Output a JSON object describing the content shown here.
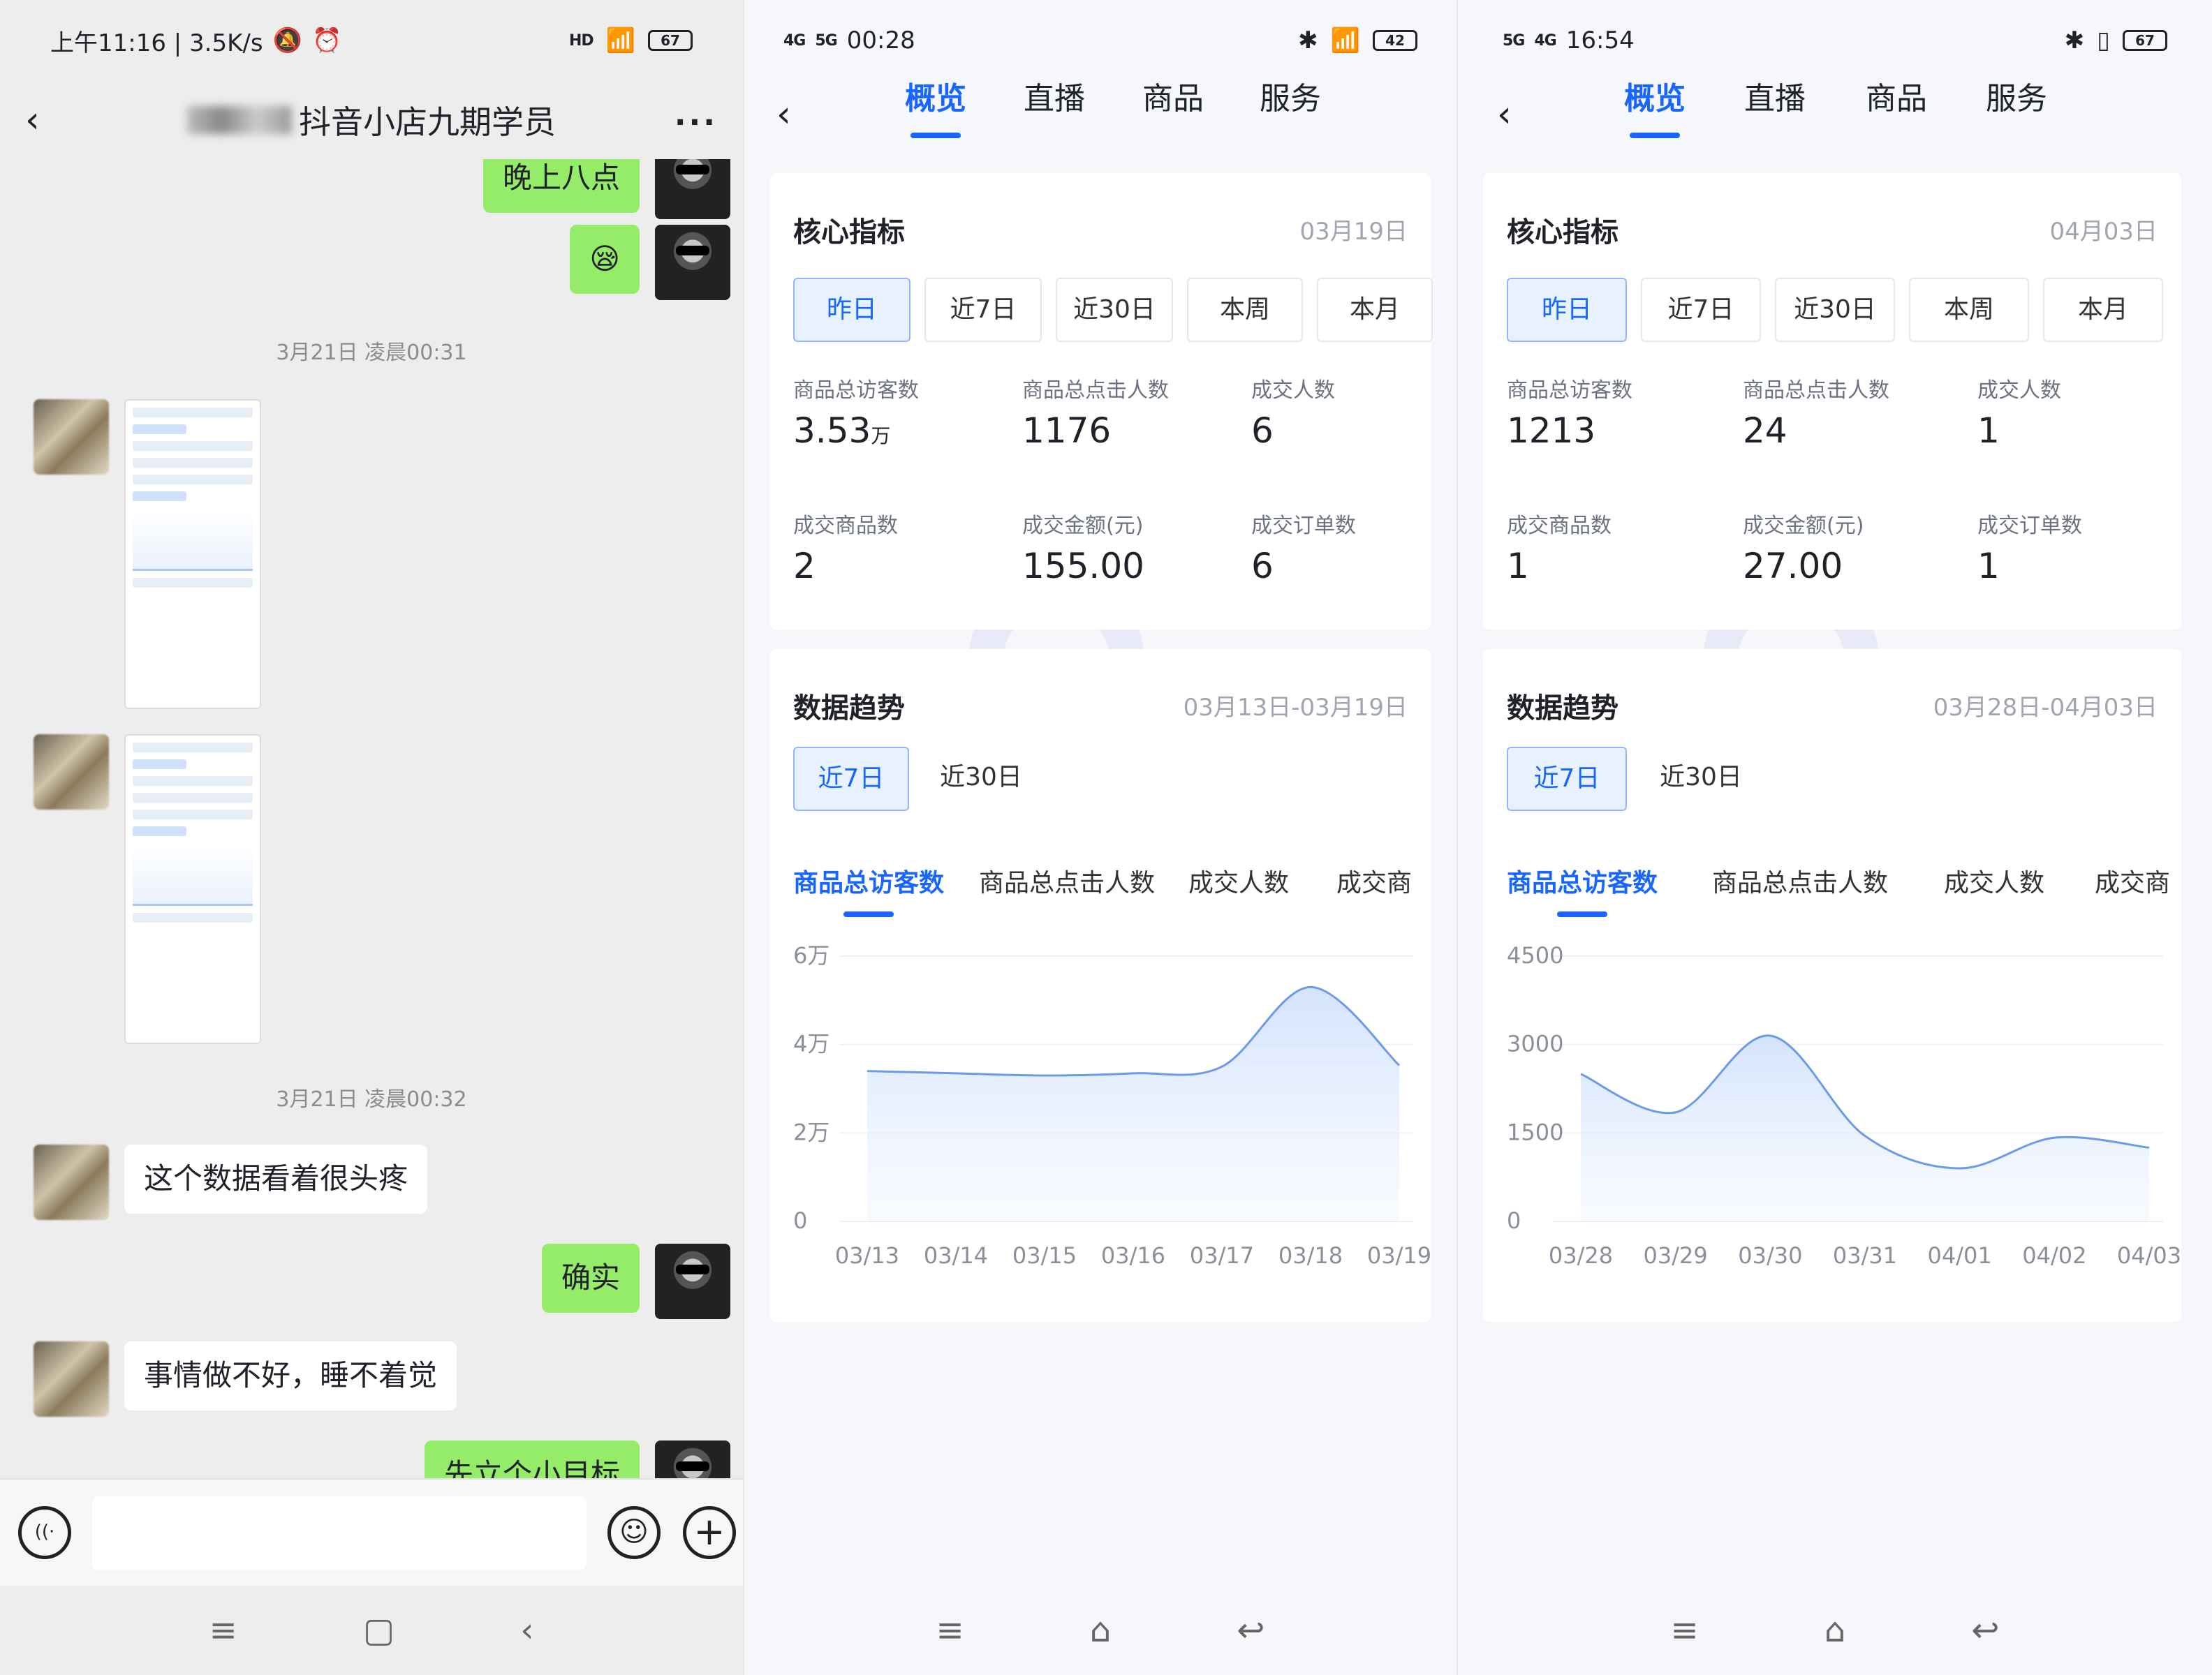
{
  "wechat": {
    "status": {
      "time_speed": "上午11:16 | 3.5K/s",
      "battery": "67",
      "hd": "HD"
    },
    "title": "抖音小店九期学员",
    "messages": {
      "m1": "晚上八点",
      "emoji": "😪",
      "ts1": "3月21日 凌晨00:31",
      "ts2": "3月21日 凌晨00:32",
      "m2": "这个数据看着很头疼",
      "m3": "确实",
      "m4": "事情做不好，睡不着觉",
      "m5": "先立个小目标"
    },
    "icons": {
      "back": "‹",
      "more": "···",
      "voice": "((·",
      "emoji": "☺",
      "plus": "+"
    }
  },
  "dy1": {
    "status": {
      "time": "00:28",
      "net1": "4G",
      "net2": "5G",
      "battery": "42"
    },
    "tabs": [
      "概览",
      "直播",
      "商品",
      "服务"
    ],
    "core": {
      "title": "核心指标",
      "date": "03月19日",
      "periods": [
        "昨日",
        "近7日",
        "近30日",
        "本周",
        "本月"
      ],
      "metrics": [
        {
          "label": "商品总访客数",
          "value": "3.53",
          "unit": "万"
        },
        {
          "label": "商品总点击人数",
          "value": "1176",
          "unit": ""
        },
        {
          "label": "成交人数",
          "value": "6",
          "unit": ""
        },
        {
          "label": "成交商品数",
          "value": "2",
          "unit": ""
        },
        {
          "label": "成交金额(元)",
          "value": "155.00",
          "unit": ""
        },
        {
          "label": "成交订单数",
          "value": "6",
          "unit": ""
        }
      ]
    },
    "trend": {
      "title": "数据趋势",
      "date": "03月13日-03月19日",
      "periods": [
        "近7日",
        "近30日"
      ],
      "tabs": [
        "商品总访客数",
        "商品总点击人数",
        "成交人数",
        "成交商"
      ]
    },
    "chart_data": {
      "type": "area",
      "x": [
        "03/13",
        "03/14",
        "03/15",
        "03/16",
        "03/17",
        "03/18",
        "03/19"
      ],
      "yticks": [
        "0",
        "2万",
        "4万",
        "6万"
      ],
      "ylim": [
        0,
        60000
      ],
      "values": [
        34000,
        33500,
        33000,
        33500,
        35000,
        53000,
        35300
      ]
    }
  },
  "dy2": {
    "status": {
      "time": "16:54",
      "net1": "5G",
      "net2": "4G",
      "battery": "67"
    },
    "tabs": [
      "概览",
      "直播",
      "商品",
      "服务"
    ],
    "core": {
      "title": "核心指标",
      "date": "04月03日",
      "periods": [
        "昨日",
        "近7日",
        "近30日",
        "本周",
        "本月"
      ],
      "metrics": [
        {
          "label": "商品总访客数",
          "value": "1213",
          "unit": ""
        },
        {
          "label": "商品总点击人数",
          "value": "24",
          "unit": ""
        },
        {
          "label": "成交人数",
          "value": "1",
          "unit": ""
        },
        {
          "label": "成交商品数",
          "value": "1",
          "unit": ""
        },
        {
          "label": "成交金额(元)",
          "value": "27.00",
          "unit": ""
        },
        {
          "label": "成交订单数",
          "value": "1",
          "unit": ""
        }
      ]
    },
    "trend": {
      "title": "数据趋势",
      "date": "03月28日-04月03日",
      "periods": [
        "近7日",
        "近30日"
      ],
      "tabs": [
        "商品总访客数",
        "商品总点击人数",
        "成交人数",
        "成交商"
      ]
    },
    "chart_data": {
      "type": "area",
      "x": [
        "03/28",
        "03/29",
        "03/30",
        "03/31",
        "04/01",
        "04/02",
        "04/03"
      ],
      "yticks": [
        "0",
        "1500",
        "3000",
        "4500"
      ],
      "ylim": [
        0,
        4500
      ],
      "values": [
        2500,
        1850,
        3150,
        1450,
        900,
        1420,
        1250
      ]
    }
  }
}
